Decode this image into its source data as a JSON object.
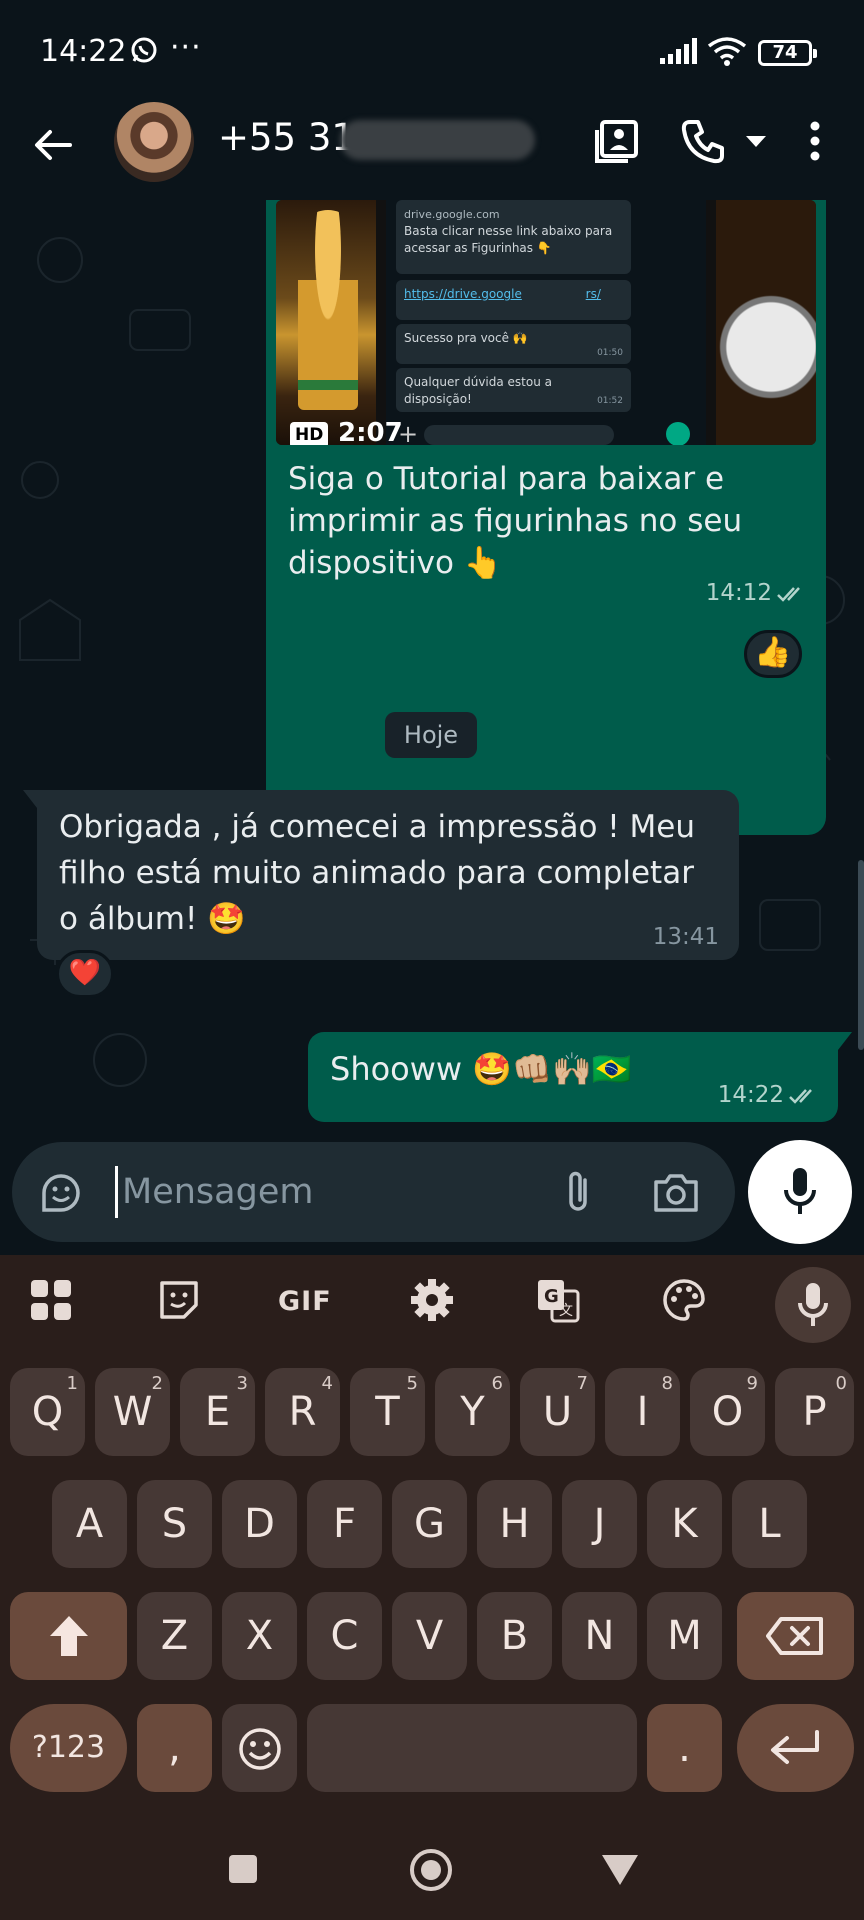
{
  "status_bar": {
    "time": "14:22",
    "dots": "···",
    "battery": "74"
  },
  "header": {
    "contact_visible": "+55 31",
    "icons": [
      "back-arrow-icon",
      "contact-card-icon",
      "phone-icon",
      "chevron-down-icon",
      "more-vert-icon"
    ]
  },
  "media_message": {
    "badge": "HD",
    "duration": "2:07",
    "thumbnail": {
      "link_domain": "drive.google.com",
      "line1": "Basta clicar nesse link abaixo para acessar as Figurinhas 👇",
      "link": "https://drive.google",
      "link_tail": "rs/",
      "msg2": "Sucesso pra você 🙌",
      "msg2_time": "01:50",
      "msg3": "Qualquer dúvida estou a disposição!",
      "msg3_time": "01:52"
    },
    "caption": "Siga o Tutorial para baixar e imprimir as figurinhas no seu dispositivo 👆",
    "time": "14:12",
    "reaction": "👍"
  },
  "day_divider": "Hoje",
  "incoming_message": {
    "text": "Obrigada , já comecei a impressão ! Meu filho está muito animado para completar o álbum! 🤩",
    "time": "13:41",
    "reaction": "❤️"
  },
  "outgoing_message": {
    "text": "Shooww 🤩👊🏼🙌🏼🇧🇷",
    "time": "14:22"
  },
  "composer": {
    "placeholder": "Mensagem"
  },
  "keyboard": {
    "toolbar": {
      "gif": "GIF"
    },
    "row1": [
      {
        "k": "Q",
        "n": "1"
      },
      {
        "k": "W",
        "n": "2"
      },
      {
        "k": "E",
        "n": "3"
      },
      {
        "k": "R",
        "n": "4"
      },
      {
        "k": "T",
        "n": "5"
      },
      {
        "k": "Y",
        "n": "6"
      },
      {
        "k": "U",
        "n": "7"
      },
      {
        "k": "I",
        "n": "8"
      },
      {
        "k": "O",
        "n": "9"
      },
      {
        "k": "P",
        "n": "0"
      }
    ],
    "row2": [
      "A",
      "S",
      "D",
      "F",
      "G",
      "H",
      "J",
      "K",
      "L"
    ],
    "row3": [
      "Z",
      "X",
      "C",
      "V",
      "B",
      "N",
      "M"
    ],
    "symbols_label": "?123",
    "comma": ",",
    "period": "."
  },
  "colors": {
    "outgoing_bubble": "#005c4b",
    "incoming_bubble": "#202c33",
    "background": "#0b141a",
    "keyboard_bg": "#2a1e1b"
  }
}
